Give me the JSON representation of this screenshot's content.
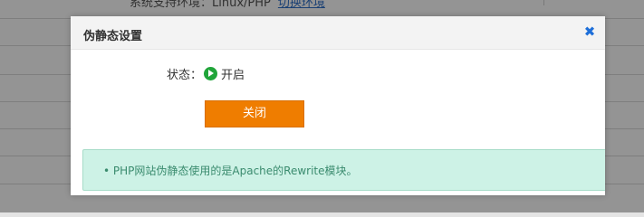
{
  "background": {
    "env_label": "系统支持环境：",
    "env_value": "Linux/PHP",
    "switch_link": "切换环境"
  },
  "dialog": {
    "title": "伪静态设置",
    "close_icon": "close-x-icon",
    "status_label": "状态：",
    "status_icon": "play-circle-icon",
    "status_value": "开启",
    "close_button_label": "关闭",
    "info_text": "• PHP网站伪静态使用的是Apache的Rewrite模块。"
  },
  "colors": {
    "accent_orange": "#ef7d00",
    "status_green": "#20a53a",
    "info_bg": "#cdf2e6",
    "info_text": "#3a8b6e",
    "close_icon_blue": "#1e6fd9"
  }
}
